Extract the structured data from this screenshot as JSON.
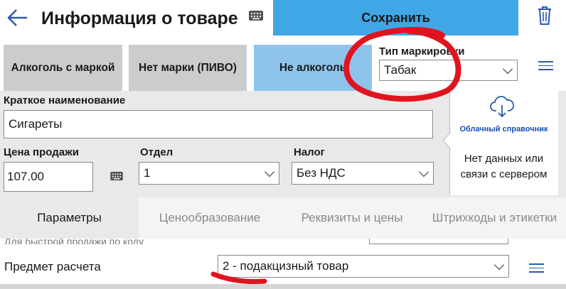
{
  "header": {
    "title": "Информация о товаре",
    "save_label": "Сохранить"
  },
  "type_buttons": [
    "Алкоголь с маркой",
    "Нет марки (ПИВО)",
    "Не алкоголь"
  ],
  "marking": {
    "label": "Тип маркировки",
    "value": "Табак"
  },
  "form": {
    "short_name_label": "Краткое наименование",
    "short_name_value": "Сигареты",
    "price_label": "Цена продажи",
    "price_value": "107.00",
    "dept_label": "Отдел",
    "dept_value": "1",
    "tax_label": "Налог",
    "tax_value": "Без НДС"
  },
  "cloud": {
    "title": "Облачный справочник",
    "status": "Нет данных или связи с сервером"
  },
  "tabs": [
    "Параметры",
    "Ценообразование",
    "Реквизиты и цены",
    "Штрихкоды и этикетки"
  ],
  "bottom": {
    "partial_text": "Для быстрой продажи по коду",
    "subject_label": "Предмет расчета",
    "subject_value": "2 - подакцизный товар"
  },
  "colors": {
    "accent": "#41a6e6",
    "selected_type": "#8ec4ec",
    "annotation": "#e0141e",
    "icon_blue": "#2a5aa8"
  }
}
